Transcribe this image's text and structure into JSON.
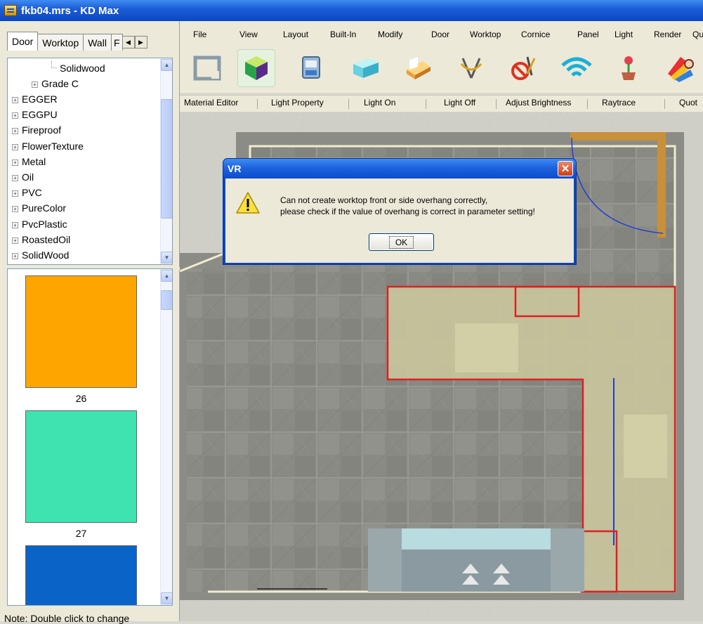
{
  "window": {
    "title": "fkb04.mrs - KD Max"
  },
  "left_panel": {
    "tabs": [
      "Door",
      "Worktop",
      "Wall",
      "F"
    ],
    "tree": [
      {
        "label": "Solidwood",
        "level": 2
      },
      {
        "label": "Grade C",
        "level": 1,
        "expandable": true
      },
      {
        "label": "EGGER",
        "level": 0,
        "expandable": true
      },
      {
        "label": "EGGPU",
        "level": 0,
        "expandable": true
      },
      {
        "label": "Fireproof",
        "level": 0,
        "expandable": true
      },
      {
        "label": "FlowerTexture",
        "level": 0,
        "expandable": true
      },
      {
        "label": "Metal",
        "level": 0,
        "expandable": true
      },
      {
        "label": "Oil",
        "level": 0,
        "expandable": true
      },
      {
        "label": "PVC",
        "level": 0,
        "expandable": true
      },
      {
        "label": "PureColor",
        "level": 0,
        "expandable": true
      },
      {
        "label": "PvcPlastic",
        "level": 0,
        "expandable": true
      },
      {
        "label": "RoastedOil",
        "level": 0,
        "expandable": true
      },
      {
        "label": "SolidWood",
        "level": 0,
        "expandable": true
      }
    ],
    "swatches": [
      {
        "label": "26",
        "color": "#ffa500"
      },
      {
        "label": "27",
        "color": "#3ee3b0"
      },
      {
        "label": "",
        "color": "#0a64c8"
      }
    ],
    "note": "Note: Double click to change"
  },
  "menu": [
    "File",
    "View",
    "Layout",
    "Built-In",
    "Modify",
    "Door",
    "Worktop",
    "Cornice",
    "Panel",
    "Light",
    "Render",
    "Qu"
  ],
  "toolbar_icons": [
    "blank-frame-icon",
    "color-cube-icon",
    "monitor-settings-icon",
    "cabinet-icon",
    "wood-panel-icon",
    "drafting-tool-icon",
    "no-tool-icon",
    "wireless-light-icon",
    "flower-pot-icon",
    "color-palette-icon"
  ],
  "subtoolbar": [
    "Material Editor",
    "Light Property",
    "Light On",
    "Light Off",
    "Adjust Brightness",
    "Raytrace",
    "Quot"
  ],
  "dialog": {
    "title": "VR",
    "message_line1": "Can not create worktop front or side overhang correctly,",
    "message_line2": "please check if the value of overhang is correct in parameter setting!",
    "ok_label": "OK"
  }
}
